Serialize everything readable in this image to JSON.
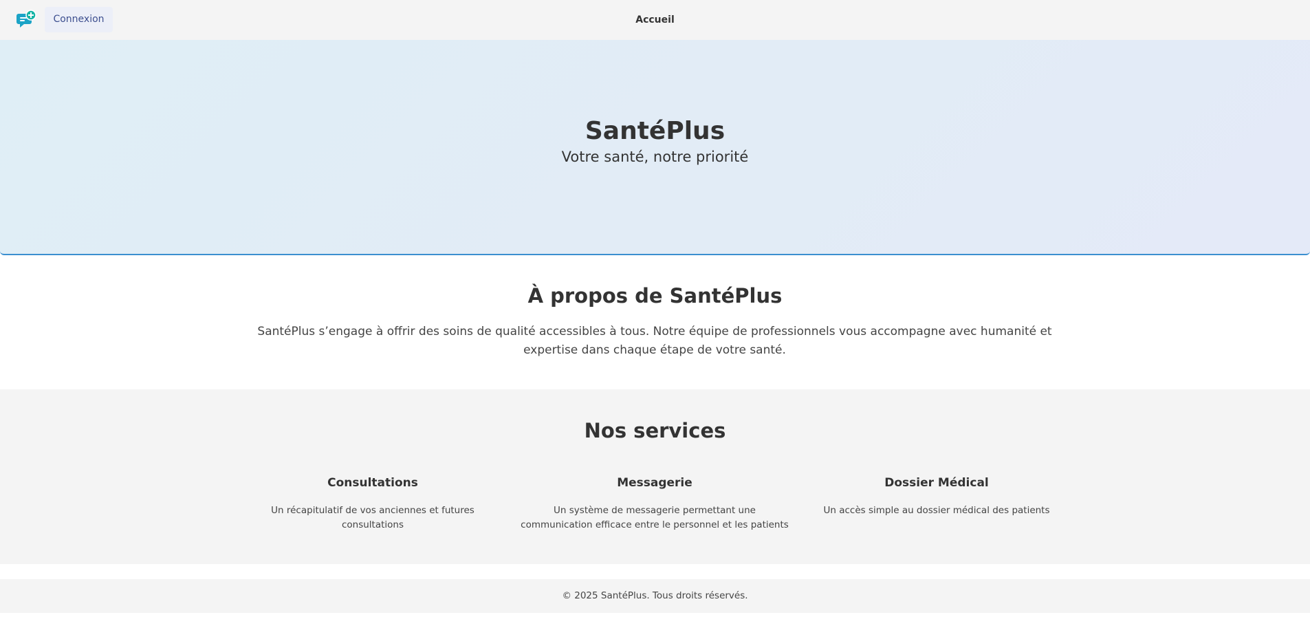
{
  "header": {
    "login_label": "Connexion",
    "nav_home": "Accueil",
    "logo_icon": "chat-plus-icon"
  },
  "hero": {
    "title": "SantéPlus",
    "subtitle": "Votre santé, notre priorité"
  },
  "about": {
    "title": "À propos de SantéPlus",
    "text": "SantéPlus s’engage à offrir des soins de qualité accessibles à tous. Notre équipe de professionnels vous accompagne avec humanité et expertise dans chaque étape de votre santé."
  },
  "services": {
    "title": "Nos services",
    "items": [
      {
        "title": "Consultations",
        "desc": "Un récapitulatif de vos anciennes et futures consultations"
      },
      {
        "title": "Messagerie",
        "desc": "Un système de messagerie permettant une communication efficace entre le personnel et les patients"
      },
      {
        "title": "Dossier Médical",
        "desc": "Un accès simple au dossier médical des patients"
      }
    ]
  },
  "footer": {
    "text": "© 2025 SantéPlus. Tous droits réservés."
  },
  "colors": {
    "accent": "#1ba3c6",
    "button_bg": "#eceff8",
    "button_text": "#3d4f8f",
    "hero_border": "#3b8fd0"
  }
}
